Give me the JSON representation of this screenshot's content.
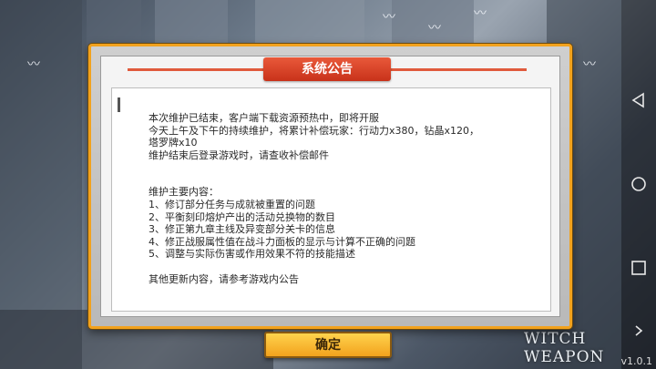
{
  "dialog": {
    "title": "系统公告",
    "lines": [
      "本次维护已结束，客户端下载资源预热中，即将开服",
      "今天上午及下午的持续维护，将累计补偿玩家：行动力x380，钻晶x120，",
      "塔罗牌x10",
      "维护结束后登录游戏时，请查收补偿邮件"
    ],
    "section_title": "维护主要内容：",
    "items": [
      "1、修订部分任务与成就被重置的问题",
      "2、平衡刻印熔炉产出的活动兑换物的数目",
      "3、修正第九章主线及异变部分关卡的信息",
      "4、修正战服属性值在战斗力面板的显示与计算不正确的问题",
      "5、调整与实际伤害或作用效果不符的技能描述"
    ],
    "footer": "其他更新内容，请参考游戏内公告",
    "confirm_label": "确定"
  },
  "branding": {
    "logo": "WITCH WEAPON",
    "version": "v1.0.1"
  },
  "nav": {
    "back_icon": "back-triangle-icon",
    "home_icon": "home-circle-icon",
    "recents_icon": "recents-square-icon"
  },
  "colors": {
    "frame": "#f2a21d",
    "title": "#d8442a",
    "button": "#ffc53a"
  }
}
